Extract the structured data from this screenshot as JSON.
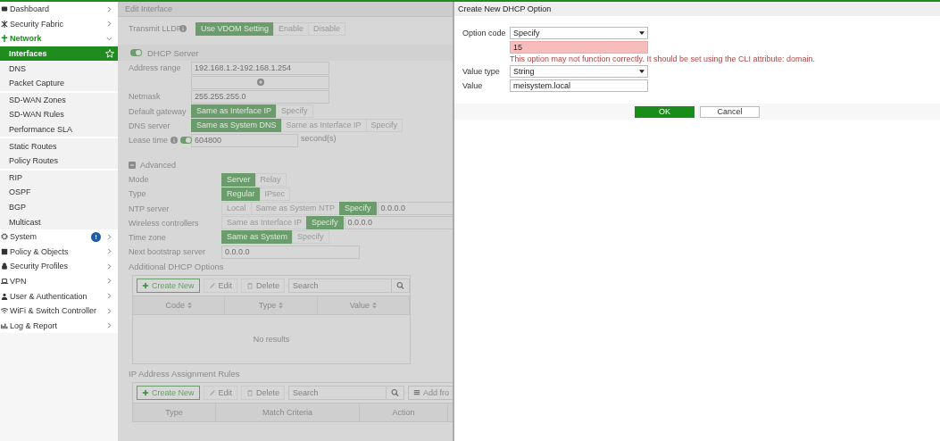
{
  "sidebar": {
    "items": [
      {
        "label": "Dashboard",
        "expanded": false
      },
      {
        "label": "Security Fabric",
        "expanded": false
      },
      {
        "label": "Network",
        "expanded": true,
        "children": [
          {
            "label": "Interfaces",
            "selected": true,
            "divider_above": false
          },
          {
            "label": "DNS",
            "selected": false,
            "divider_above": false
          },
          {
            "label": "Packet Capture",
            "selected": false,
            "divider_above": false
          },
          {
            "label": "SD-WAN Zones",
            "selected": false,
            "divider_above": true
          },
          {
            "label": "SD-WAN Rules",
            "selected": false,
            "divider_above": false
          },
          {
            "label": "Performance SLA",
            "selected": false,
            "divider_above": false
          },
          {
            "label": "Static Routes",
            "selected": false,
            "divider_above": true
          },
          {
            "label": "Policy Routes",
            "selected": false,
            "divider_above": false
          },
          {
            "label": "RIP",
            "selected": false,
            "divider_above": true
          },
          {
            "label": "OSPF",
            "selected": false,
            "divider_above": false
          },
          {
            "label": "BGP",
            "selected": false,
            "divider_above": false
          },
          {
            "label": "Multicast",
            "selected": false,
            "divider_above": false
          }
        ]
      },
      {
        "label": "System",
        "expanded": false,
        "badge": "!"
      },
      {
        "label": "Policy & Objects",
        "expanded": false
      },
      {
        "label": "Security Profiles",
        "expanded": false
      },
      {
        "label": "VPN",
        "expanded": false
      },
      {
        "label": "User & Authentication",
        "expanded": false
      },
      {
        "label": "WiFi & Switch Controller",
        "expanded": false
      },
      {
        "label": "Log & Report",
        "expanded": false
      }
    ]
  },
  "panel": {
    "title": "Edit Interface",
    "lldp": {
      "label": "Transmit LLDP",
      "options": [
        {
          "label": "Use VDOM Setting",
          "selected": true
        },
        {
          "label": "Enable",
          "selected": false
        },
        {
          "label": "Disable",
          "selected": false
        }
      ]
    },
    "dhcp_server": {
      "label": "DHCP Server",
      "on": true
    },
    "rows": [
      {
        "kind": "range",
        "label": "Address range",
        "value": "192.168.1.2-192.168.1.254"
      },
      {
        "kind": "input",
        "label": "Netmask",
        "value": "255.255.255.0"
      },
      {
        "kind": "segmented",
        "label": "Default gateway",
        "options": [
          {
            "label": "Same as Interface IP",
            "selected": true
          },
          {
            "label": "Specify",
            "selected": false
          }
        ]
      },
      {
        "kind": "segmented",
        "label": "DNS server",
        "options": [
          {
            "label": "Same as System DNS",
            "selected": true
          },
          {
            "label": "Same as Interface IP",
            "selected": false
          },
          {
            "label": "Specify",
            "selected": false
          }
        ]
      },
      {
        "kind": "input",
        "label": "Lease time",
        "info": true,
        "toggle": {
          "on": true
        },
        "value": "604800",
        "suffix": "second(s)"
      }
    ],
    "advanced": {
      "label": "Advanced",
      "expanded": true
    },
    "advanced_rows": [
      {
        "kind": "segmented",
        "label": "Mode",
        "options": [
          {
            "label": "Server",
            "selected": true
          },
          {
            "label": "Relay",
            "selected": false
          }
        ]
      },
      {
        "kind": "segmented",
        "label": "Type",
        "options": [
          {
            "label": "Regular",
            "selected": true
          },
          {
            "label": "IPsec",
            "selected": false
          }
        ]
      },
      {
        "kind": "segmented",
        "label": "NTP server",
        "options": [
          {
            "label": "Local",
            "selected": false
          },
          {
            "label": "Same as System NTP",
            "selected": false
          },
          {
            "label": "Specify",
            "selected": true
          }
        ],
        "value": "0.0.0.0"
      },
      {
        "kind": "segmented",
        "label": "Wireless controllers",
        "options": [
          {
            "label": "Same as Interface IP",
            "selected": false
          },
          {
            "label": "Specify",
            "selected": true
          }
        ],
        "value": "0.0.0.0"
      },
      {
        "kind": "segmented",
        "label": "Time zone",
        "options": [
          {
            "label": "Same as System",
            "selected": true
          },
          {
            "label": "Specify",
            "selected": false
          }
        ]
      },
      {
        "kind": "input",
        "label": "Next bootstrap server",
        "value": "0.0.0.0"
      }
    ],
    "tables": [
      {
        "title": "Additional DHCP Options",
        "toolbar": [
          {
            "kind": "create",
            "label": "Create New",
            "disabled": false
          },
          {
            "kind": "edit",
            "label": "Edit",
            "disabled": true
          },
          {
            "kind": "delete",
            "label": "Delete",
            "disabled": true
          }
        ],
        "search": {
          "placeholder": "Search"
        },
        "columns": [
          {
            "label": "Code",
            "sortable": true
          },
          {
            "label": "Type",
            "sortable": true
          },
          {
            "label": "Value",
            "sortable": true
          }
        ],
        "empty": "No results"
      },
      {
        "title": "IP Address Assignment Rules",
        "toolbar": [
          {
            "kind": "create",
            "label": "Create New",
            "disabled": false
          },
          {
            "kind": "edit",
            "label": "Edit",
            "disabled": true
          },
          {
            "kind": "delete",
            "label": "Delete",
            "disabled": true
          }
        ],
        "search": {
          "placeholder": "Search"
        },
        "extra_button": "Add fro",
        "columns": [
          {
            "label": "Type",
            "sortable": false
          },
          {
            "label": "Match Criteria",
            "sortable": false
          },
          {
            "label": "Action",
            "sortable": false
          }
        ]
      }
    ]
  },
  "dialog": {
    "title": "Create New DHCP Option",
    "option_code": {
      "label": "Option code",
      "value": "Specify"
    },
    "code_input": {
      "value": "15",
      "invalid": true
    },
    "error": "This option may not function correctly. It should be set using the CLI attribute: domain.",
    "value_type": {
      "label": "Value type",
      "value": "String"
    },
    "value": {
      "label": "Value",
      "value": "meisystem.local"
    },
    "buttons": [
      {
        "label": "OK",
        "primary": true
      },
      {
        "label": "Cancel",
        "primary": false
      }
    ]
  }
}
